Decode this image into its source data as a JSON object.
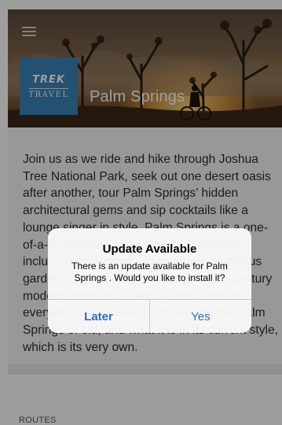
{
  "header": {
    "logo": {
      "brand": "TREK",
      "sub": "TRAVEL"
    },
    "title": "Palm Springs",
    "menu_icon": "hamburger-icon"
  },
  "description": "Join us as we ride and hike through Joshua Tree National Park, seek out one desert oasis after another, tour Palm Springs’ hidden architectural gems and sip cocktails like a lounge singer in style. Palm Springs is a one-of-a-kind place where desert landscapes include palm-fringed oases, dramatic cactus gardens and mountain vistas with mid-century modern architecture and a retro town feel everywhere you look. Discover and the Palm Springs of old, and what it is in its current style, which is its very own.",
  "sections": {
    "routes_label": "ROUTES"
  },
  "alert": {
    "title": "Update Available",
    "message": "There is an update available for Palm Springs . Would you like to install it?",
    "buttons": {
      "later": "Later",
      "yes": "Yes"
    }
  },
  "colors": {
    "logo_bg": "#3b82b6",
    "alert_button_text": "#2f6fb3",
    "overlay": "rgba(0,0,0,0.38)"
  }
}
